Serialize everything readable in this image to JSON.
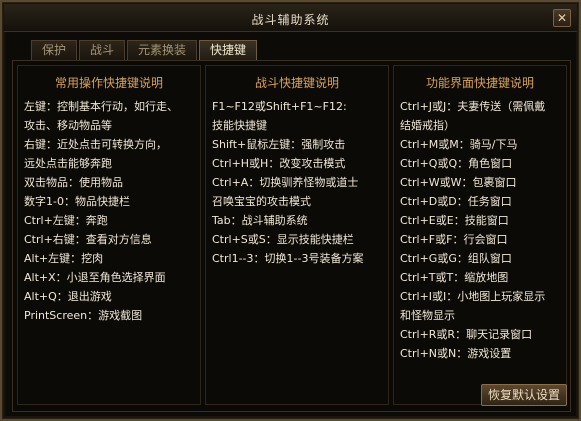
{
  "window": {
    "title": "战斗辅助系统",
    "close_label": "✕"
  },
  "tabs": [
    {
      "label": "保护"
    },
    {
      "label": "战斗"
    },
    {
      "label": "元素换装"
    },
    {
      "label": "快捷键"
    }
  ],
  "panels": {
    "general": {
      "title": "常用操作快捷键说明",
      "lines": [
        "左键：控制基本行动，如行走、",
        "攻击、移动物品等",
        "右键：近处点击可转换方向，",
        "远处点击能够奔跑",
        "双击物品：使用物品",
        "数字1-0：物品快捷栏",
        "Ctrl+左键：奔跑",
        "Ctrl+右键：查看对方信息",
        "Alt+左键：挖肉",
        "Alt+X：小退至角色选择界面",
        "Alt+Q：退出游戏",
        "PrintScreen：游戏截图"
      ]
    },
    "combat": {
      "title": "战斗快捷键说明",
      "lines": [
        "F1~F12或Shift+F1~F12:",
        "技能快捷键",
        "Shift+鼠标左键：强制攻击",
        "Ctrl+H或H：改变攻击模式",
        "Ctrl+A：切换驯养怪物或道士",
        "召唤宝宝的攻击模式",
        "Tab：战斗辅助系统",
        "Ctrl+S或S：显示技能快捷栏",
        "Ctrl1--3：切换1--3号装备方案"
      ]
    },
    "interface": {
      "title": "功能界面快捷键说明",
      "lines": [
        "Ctrl+J或J：夫妻传送（需佩戴",
        "结婚戒指）",
        "Ctrl+M或M：骑马/下马",
        "Ctrl+Q或Q：角色窗口",
        "Ctrl+W或W：包裹窗口",
        "Ctrl+D或D：任务窗口",
        "Ctrl+E或E：技能窗口",
        "Ctrl+F或F：行会窗口",
        "Ctrl+G或G：组队窗口",
        "Ctrl+T或T：缩放地图",
        "Ctrl+I或I：小地图上玩家显示",
        "和怪物显示",
        "Ctrl+R或R：聊天记录窗口",
        "Ctrl+N或N：游戏设置"
      ]
    }
  },
  "reset_button": {
    "label": "恢复默认设置"
  }
}
